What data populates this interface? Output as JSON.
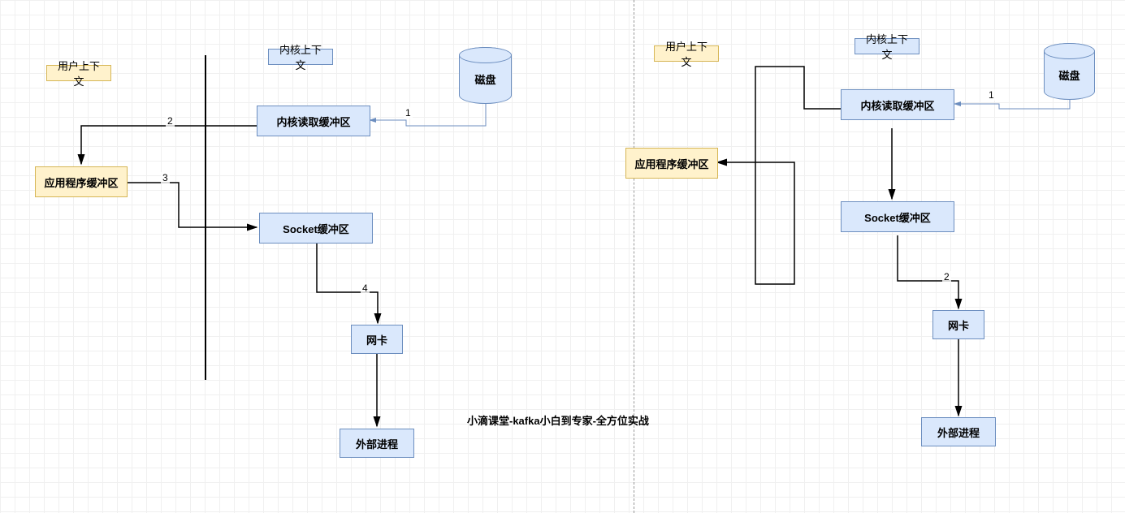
{
  "left": {
    "user_context": "用户上下文",
    "kernel_context": "内核上下文",
    "disk": "磁盘",
    "kernel_read_buffer": "内核读取缓冲区",
    "app_buffer": "应用程序缓冲区",
    "socket_buffer": "Socket缓冲区",
    "nic": "网卡",
    "external_process": "外部进程",
    "labels": {
      "e1": "1",
      "e2": "2",
      "e3": "3",
      "e4": "4"
    }
  },
  "right": {
    "user_context": "用户上下文",
    "kernel_context": "内核上下文",
    "disk": "磁盘",
    "kernel_read_buffer": "内核读取缓冲区",
    "app_buffer": "应用程序缓冲区",
    "socket_buffer": "Socket缓冲区",
    "nic": "网卡",
    "external_process": "外部进程",
    "labels": {
      "e1": "1",
      "e2": "2"
    }
  },
  "footer": "小滴课堂-kafka小白到专家-全方位实战"
}
